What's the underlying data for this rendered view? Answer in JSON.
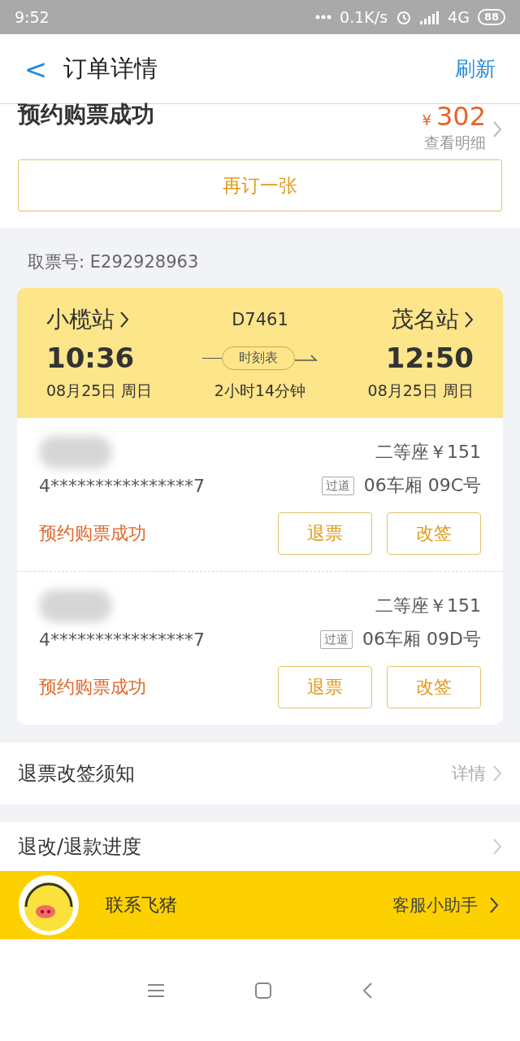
{
  "status_bar": {
    "time": "9:52",
    "speed": "0.1K/s",
    "network": "4G",
    "battery": "88"
  },
  "header": {
    "back": "<",
    "title": "订单详情",
    "action": "刷新"
  },
  "summary": {
    "status": "预约购票成功",
    "currency": "¥",
    "price": "302",
    "detail_link": "查看明细",
    "rebook_button": "再订一张"
  },
  "pickup_code": "取票号: E292928963",
  "trip": {
    "from": "小榄站",
    "to": "茂名站",
    "train": "D7461",
    "depart_time": "10:36",
    "arrive_time": "12:50",
    "timetable": "时刻表",
    "depart_date": "08月25日 周日",
    "duration": "2小时14分钟",
    "arrive_date": "08月25日 周日"
  },
  "passengers": [
    {
      "id_number": "4****************7",
      "seat_class": "二等座￥151",
      "seat_tag": "过道",
      "seat": "06车厢 09C号",
      "status": "预约购票成功",
      "buttons": [
        "退票",
        "改签"
      ]
    },
    {
      "id_number": "4****************7",
      "seat_class": "二等座￥151",
      "seat_tag": "过道",
      "seat": "06车厢 09D号",
      "status": "预约购票成功",
      "buttons": [
        "退票",
        "改签"
      ]
    }
  ],
  "menu_rows": [
    {
      "label": "退票改签须知",
      "detail": "详情"
    },
    {
      "label": "退改/退款进度"
    }
  ],
  "contact_banner": {
    "label": "联系飞猪",
    "action": "客服小助手"
  }
}
